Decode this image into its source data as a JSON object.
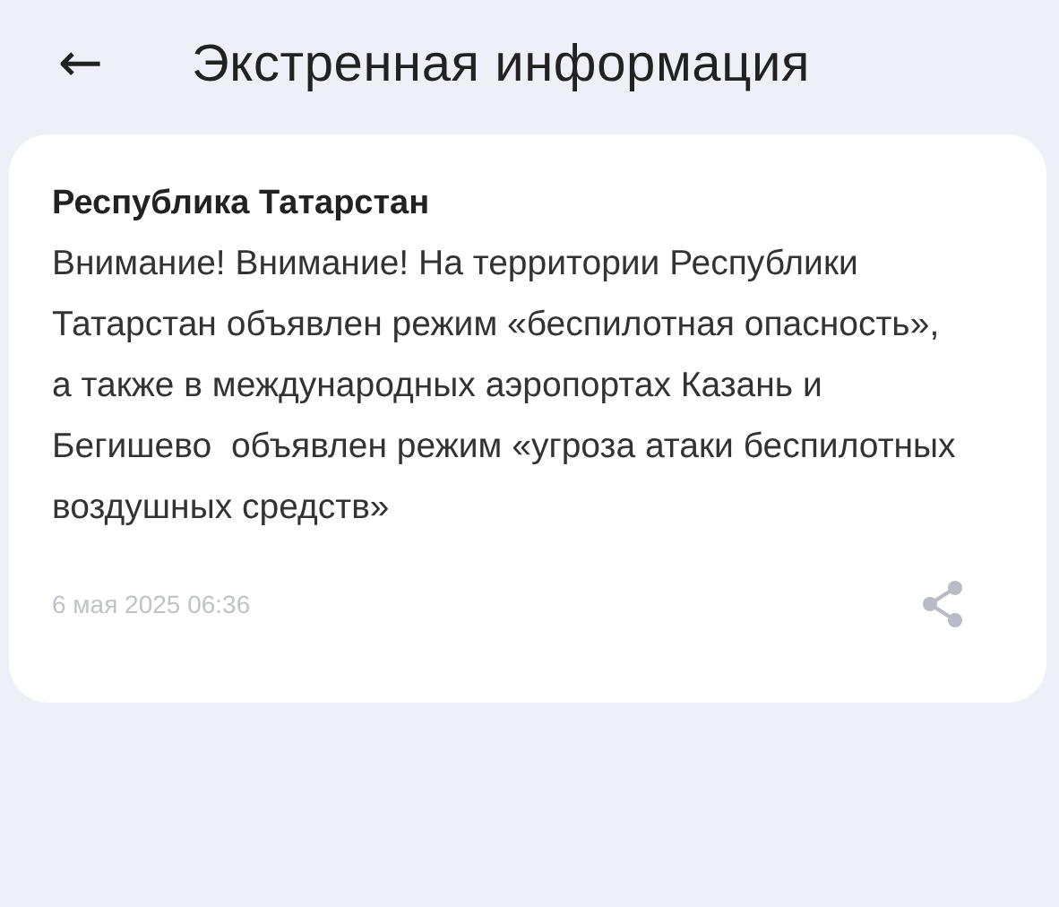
{
  "header": {
    "back_icon": "←",
    "title": "Экстренная информация"
  },
  "alert": {
    "region": "Республика Татарстан",
    "message": "Внимание! Внимание! На территории Республики Татарстан объявлен режим «беспилотная опасность», а также в международных аэропортах Казань и Бегишево  объявлен режим «угроза атаки беспилотных воздушных средств»",
    "date": "6 мая 2025 06:36"
  }
}
